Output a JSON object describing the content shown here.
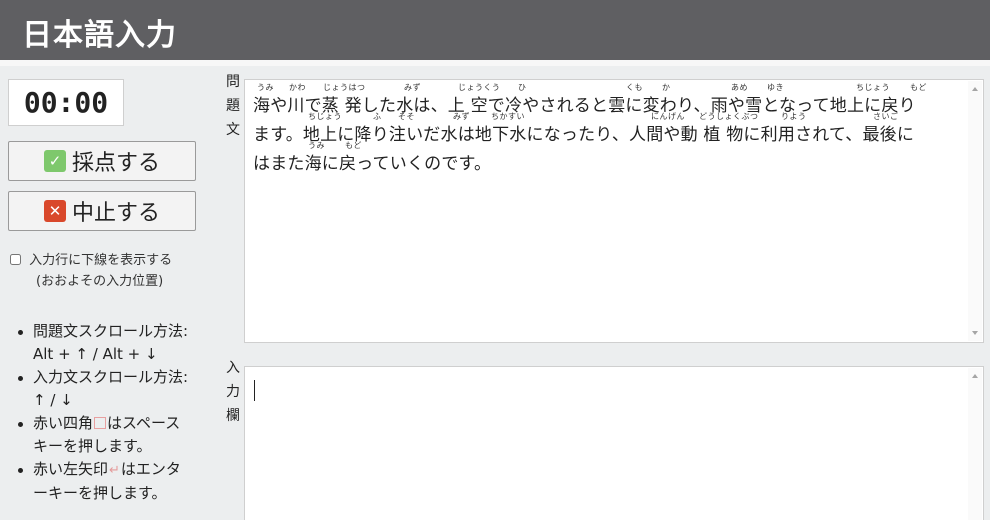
{
  "header": {
    "title": "日本語入力"
  },
  "timer": {
    "value": "00:00"
  },
  "buttons": {
    "score_label": "採点する",
    "stop_label": "中止する",
    "check_glyph": "✓",
    "x_glyph": "✕"
  },
  "options": {
    "underline_label": "入力行に下線を表示する",
    "underline_sub": "(おおよその入力位置)",
    "underline_checked": false
  },
  "help": {
    "item1_a": "問題文スクロール方法:",
    "item1_b": "Alt + ↑ / Alt + ↓",
    "item2_a": "入力文スクロール方法:",
    "item2_b": "↑ / ↓",
    "item3_a": "赤い四角",
    "item3_b": "はスペース",
    "item3_c": "キーを押します。",
    "item4_a": "赤い左矢印",
    "item4_arrow": "↵",
    "item4_b": "はエンタ",
    "item4_c": "ーキーを押します。"
  },
  "labels": {
    "question": [
      "問",
      "題",
      "文"
    ],
    "input": [
      "入",
      "力",
      "欄"
    ]
  },
  "question": {
    "lines": [
      "海や川で蒸 発した水は、上 空で冷やされると雲に変わり、雨や雪となって地上に戻り",
      "ます。地上に降り注いだ水は地下水になったり、人間や動 植 物に利用されて、最後に",
      "はまた海に戻っていくのです。"
    ],
    "ruby": [
      [
        "うみ",
        "かわ",
        "じょうはつ",
        "みず",
        "じょうくう",
        "ひ",
        "くも",
        "か",
        "あめ",
        "ゆき",
        "ちじょう",
        "もど"
      ],
      [
        "ちじょう",
        "ふ",
        "そそ",
        "みず",
        "ちかすい",
        "にんげん",
        "どうしょくぶつ",
        "りよう",
        "さいご"
      ],
      [
        "うみ",
        "もど"
      ]
    ]
  },
  "input": {
    "value": ""
  },
  "colors": {
    "header_bg": "#5f5f62",
    "page_bg": "#eceeef",
    "check_green": "#7ec86c",
    "stop_red": "#d9482b"
  }
}
